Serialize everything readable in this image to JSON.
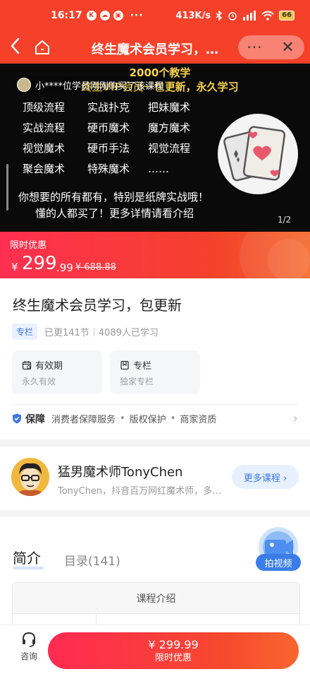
{
  "status_bar": {
    "time": "16:17",
    "notif_icons": [
      "K",
      "☁",
      "▣"
    ],
    "more": "···",
    "network_speed": "413K/s",
    "battery": "66"
  },
  "nav": {
    "title": "终生魔术会员学习，包更新",
    "more": "···",
    "close": "✕"
  },
  "banner": {
    "headline_1": "2000个教学",
    "headline_2": "终生VIP会员一包更新，永久学习",
    "notice": "小****位学员刚刚购买了该课程",
    "grid": [
      "顶级流程",
      "实战扑克",
      "把妹魔术",
      "实战流程",
      "硬币魔术",
      "魔方魔术",
      "视觉魔术",
      "硬币手法",
      "视觉流程",
      "聚会魔术",
      "特殊魔术",
      "……"
    ],
    "line1": "你想要的所有都有，特别是纸牌实战哦！",
    "line2": "懂的人都买了！更多详情请看介绍",
    "pager": "1/2"
  },
  "promo": {
    "label": "限时优惠",
    "currency": "¥",
    "price_int": "299",
    "price_dec": ".99",
    "original_price": "¥ 688.88"
  },
  "course": {
    "title": "终生魔术会员学习，包更新",
    "badge": "专栏",
    "updates": "已更141节",
    "learners": "4089人已学习",
    "features": [
      {
        "title": "有效期",
        "sub": "永久有效",
        "icon": "calendar-icon"
      },
      {
        "title": "专栏",
        "sub": "独家专栏",
        "icon": "bookmark-icon"
      }
    ],
    "guarantee": {
      "title": "保障",
      "items": [
        "消费者保障服务",
        "版权保护",
        "商家资质"
      ],
      "dot": "•",
      "arrow": "›"
    }
  },
  "teacher": {
    "name": "猛男魔术师TonyChen",
    "desc": "TonyChen，抖音百万网红魔术师，多年从事魔术教学",
    "more_button": "更多课程 ›"
  },
  "tabs": {
    "intro": "简介",
    "catalog": "目录(141)"
  },
  "table": {
    "header": "课程介绍"
  },
  "float_badge": {
    "label": "拍视频"
  },
  "bottom": {
    "consult": "咨询",
    "buy_price": "¥ 299.99",
    "buy_sub": "限时优惠"
  },
  "colors": {
    "brand_red": "#f5402a",
    "accent_blue": "#3b77e8",
    "headline_gold": "#f6d24a"
  }
}
